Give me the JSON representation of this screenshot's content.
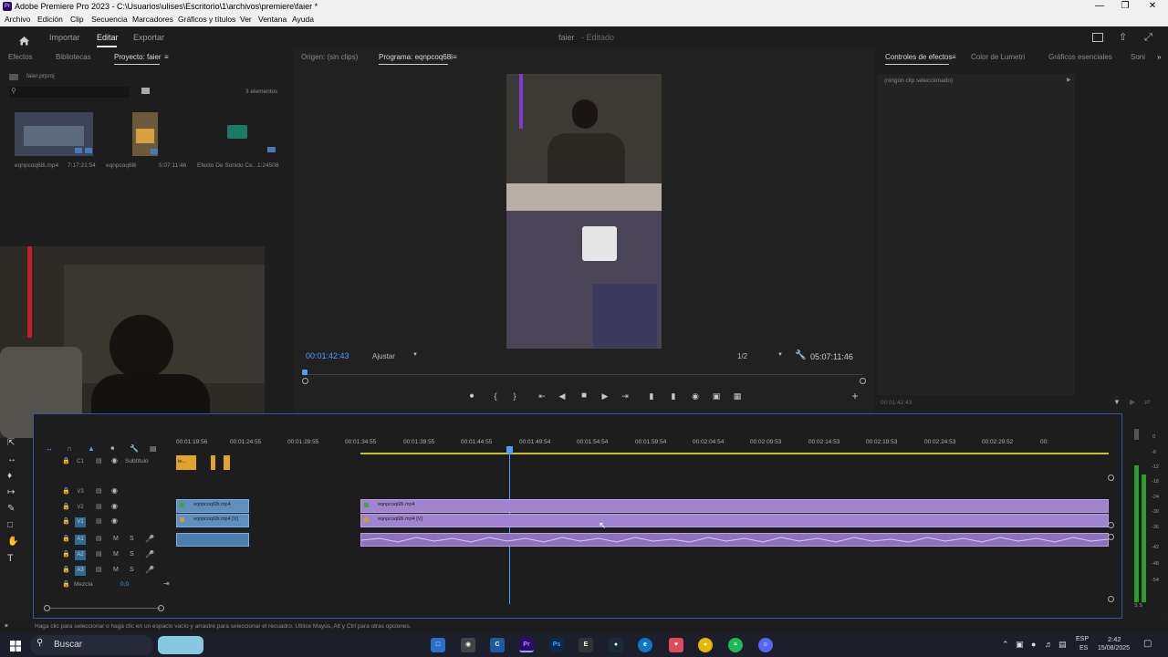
{
  "window": {
    "title": "Adobe Premiere Pro 2023 - C:\\Usuarios\\ulises\\Escritorio\\1\\archivos\\premiere\\faier *",
    "app_icon": "Pr",
    "controls": [
      "minimize",
      "maximize",
      "close"
    ]
  },
  "menu": [
    "Archivo",
    "Edición",
    "Clip",
    "Secuencia",
    "Marcadores",
    "Gráficos y títulos",
    "Ver",
    "Ventana",
    "Ayuda"
  ],
  "header": {
    "tabs": [
      "Importar",
      "Editar",
      "Exportar"
    ],
    "active_tab": "Editar",
    "project_title": "faier",
    "project_status": "- Editado"
  },
  "project_panel": {
    "tabs": [
      "Efectos",
      "Bibliotecas",
      "Proyecto: faier"
    ],
    "active_tab": "Proyecto: faier",
    "file": "faier.prproj",
    "item_count": "3 elementos",
    "items": [
      {
        "name": "eqnpcoq68i.mp4",
        "duration": "7:17:21:54"
      },
      {
        "name": "eqnpcoq68i",
        "duration": "5:07:11:46"
      },
      {
        "name": "Efecto De Sonido Ce...",
        "duration": "1:24508"
      }
    ]
  },
  "source_monitor": {
    "tabs": [
      "Origen: (sin clips)",
      "Programa: eqnpcoq68i"
    ],
    "active_tab": "Programa: eqnpcoq68i",
    "timecode": "00:01:42:43",
    "fit": "Ajustar",
    "resolution": "1/2",
    "duration": "05:07:11:46",
    "progress": 0.0
  },
  "effects_panel": {
    "tabs": [
      "Controles de efectos",
      "Color de Lumetri",
      "Gráficos esenciales",
      "Soni"
    ],
    "active_tab": "Controles de efectos",
    "placeholder": "(ningún clip seleccionado)",
    "timecode": "00:01:42:43"
  },
  "timeline": {
    "ruler": [
      "00:01:19:56",
      "00:01:24:55",
      "00:01:29:55",
      "00:01:34:55",
      "00:01:39:55",
      "00:01:44:55",
      "00:01:49:54",
      "00:01:54:54",
      "00:01:59:54",
      "00:02:04:54",
      "00:02:09:53",
      "00:02:14:53",
      "00:02:19:53",
      "00:02:24:53",
      "00:02:29:52",
      "00:"
    ],
    "tracks": {
      "subtitle": {
        "id": "C1",
        "name": "Subtítulo",
        "clip": "te..."
      },
      "video": [
        "V3",
        "V2",
        "V1"
      ],
      "audio": [
        "A1",
        "A2",
        "A3"
      ],
      "mix": {
        "label": "Mezcla",
        "value": "0,0"
      }
    },
    "clips": {
      "v2_a": "eqnpcoq68i.mp4",
      "v1_a": "eqnpcoq68i.mp4 [V]",
      "v2_b": "eqnpcoq68i.mp4",
      "v1_b": "eqnpcoq68i.mp4 [V]"
    },
    "audio_meter_labels": [
      "0",
      "-6",
      "-12",
      "-18",
      "-24",
      "-30",
      "-36",
      "-42",
      "-48",
      "-54"
    ],
    "meter_bottom": "S S"
  },
  "status_bar": "Haga clic para seleccionar o haga clic en un espacio vacío y arrastre para seleccionar el recuadro. Utilice Mayús, Alt y Ctrl para otras opciones.",
  "taskbar": {
    "search_label": "Buscar",
    "language": "ESP",
    "region": "ES",
    "time": "2:42",
    "date": "15/08/2025"
  }
}
